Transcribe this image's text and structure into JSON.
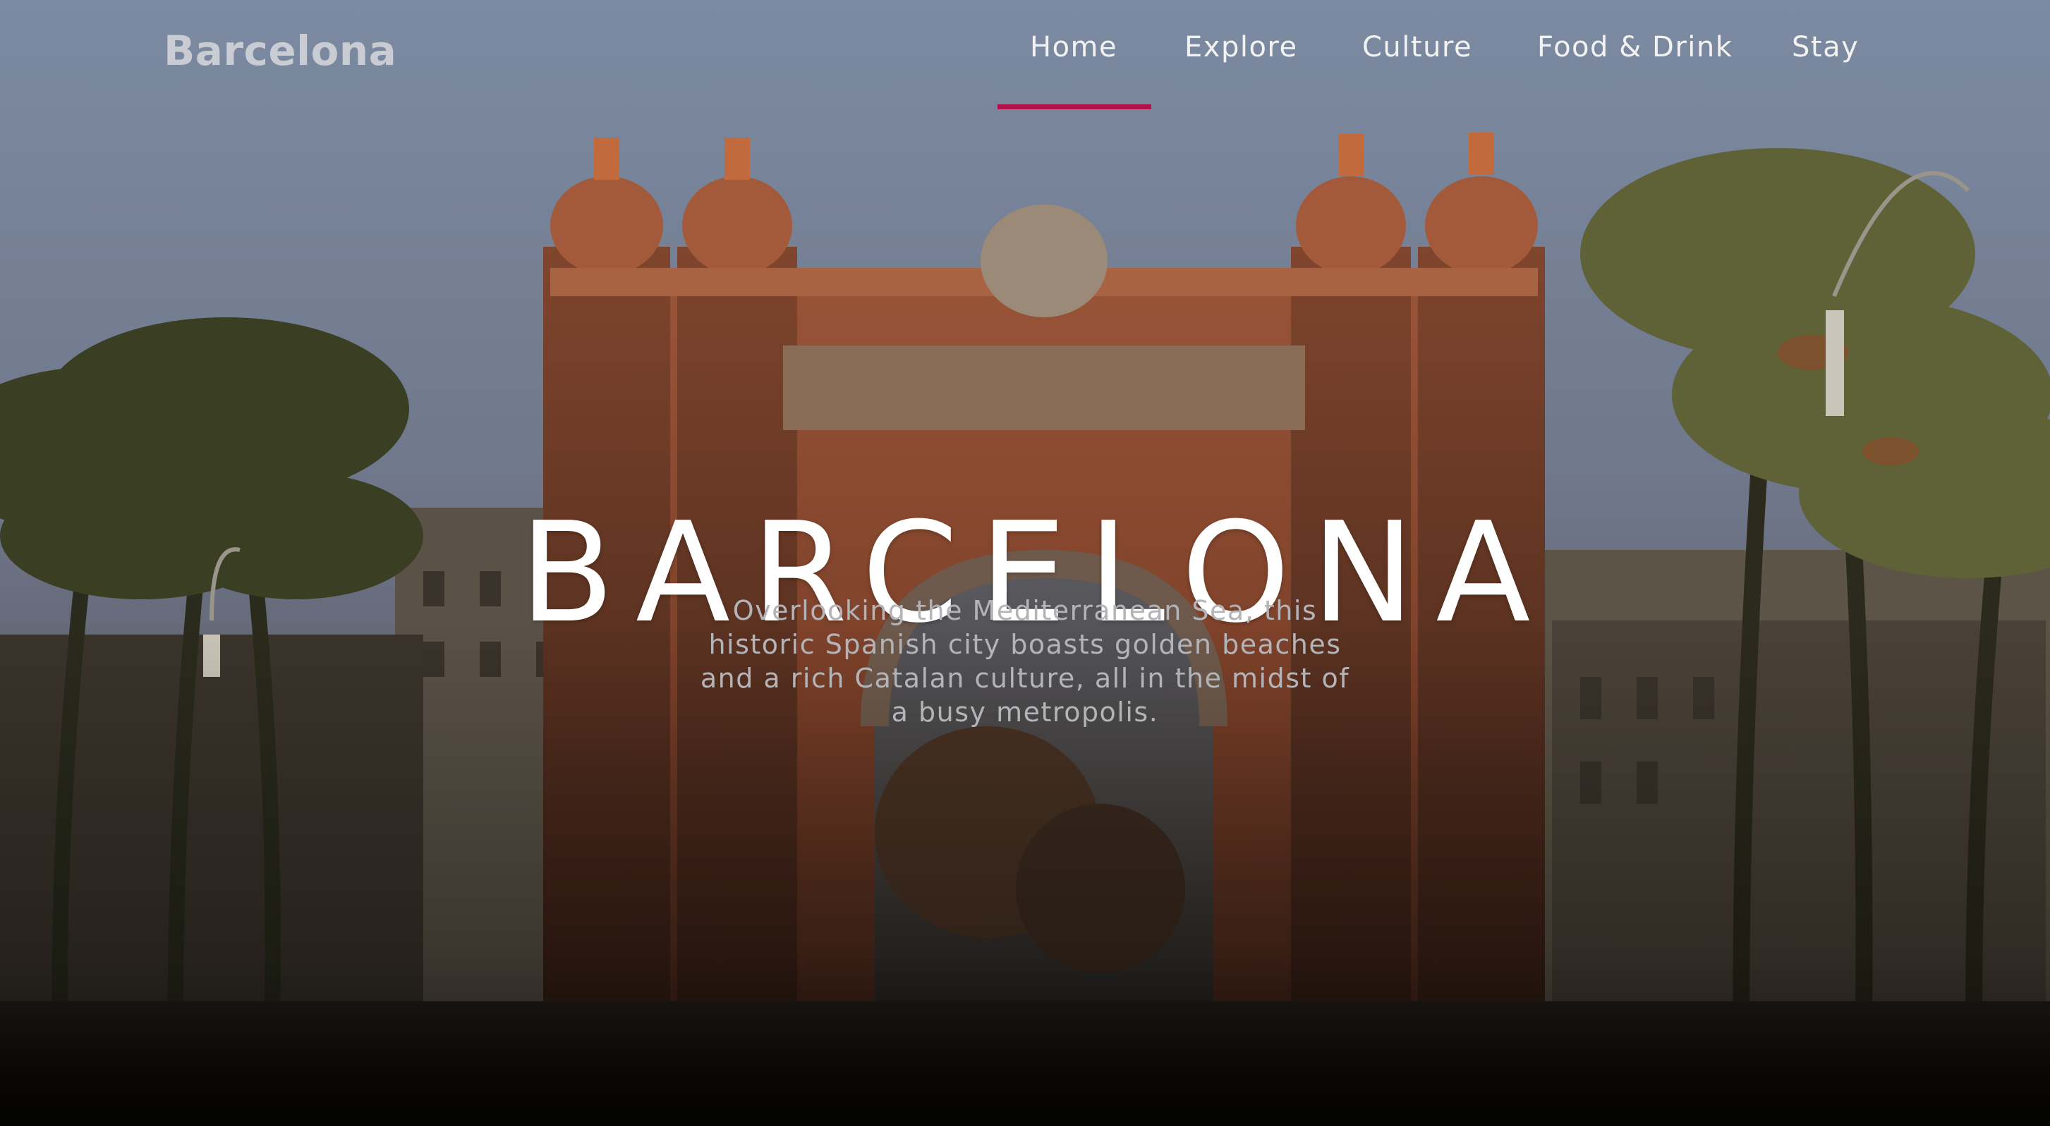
{
  "brand": {
    "name": "Barcelona"
  },
  "nav": {
    "items": [
      {
        "label": "Home",
        "active": true
      },
      {
        "label": "Explore",
        "active": false
      },
      {
        "label": "Culture",
        "active": false
      },
      {
        "label": "Food & Drink",
        "active": false
      },
      {
        "label": "Stay",
        "active": false
      }
    ],
    "active_color": "#b21048"
  },
  "hero": {
    "title": "BARCELONA",
    "tagline": "Overlooking the Mediterranean Sea, this historic Spanish city boasts golden beaches and a rich Catalan culture, all in the midst of a busy metropolis.",
    "image": "arc-de-triomf-photo"
  }
}
